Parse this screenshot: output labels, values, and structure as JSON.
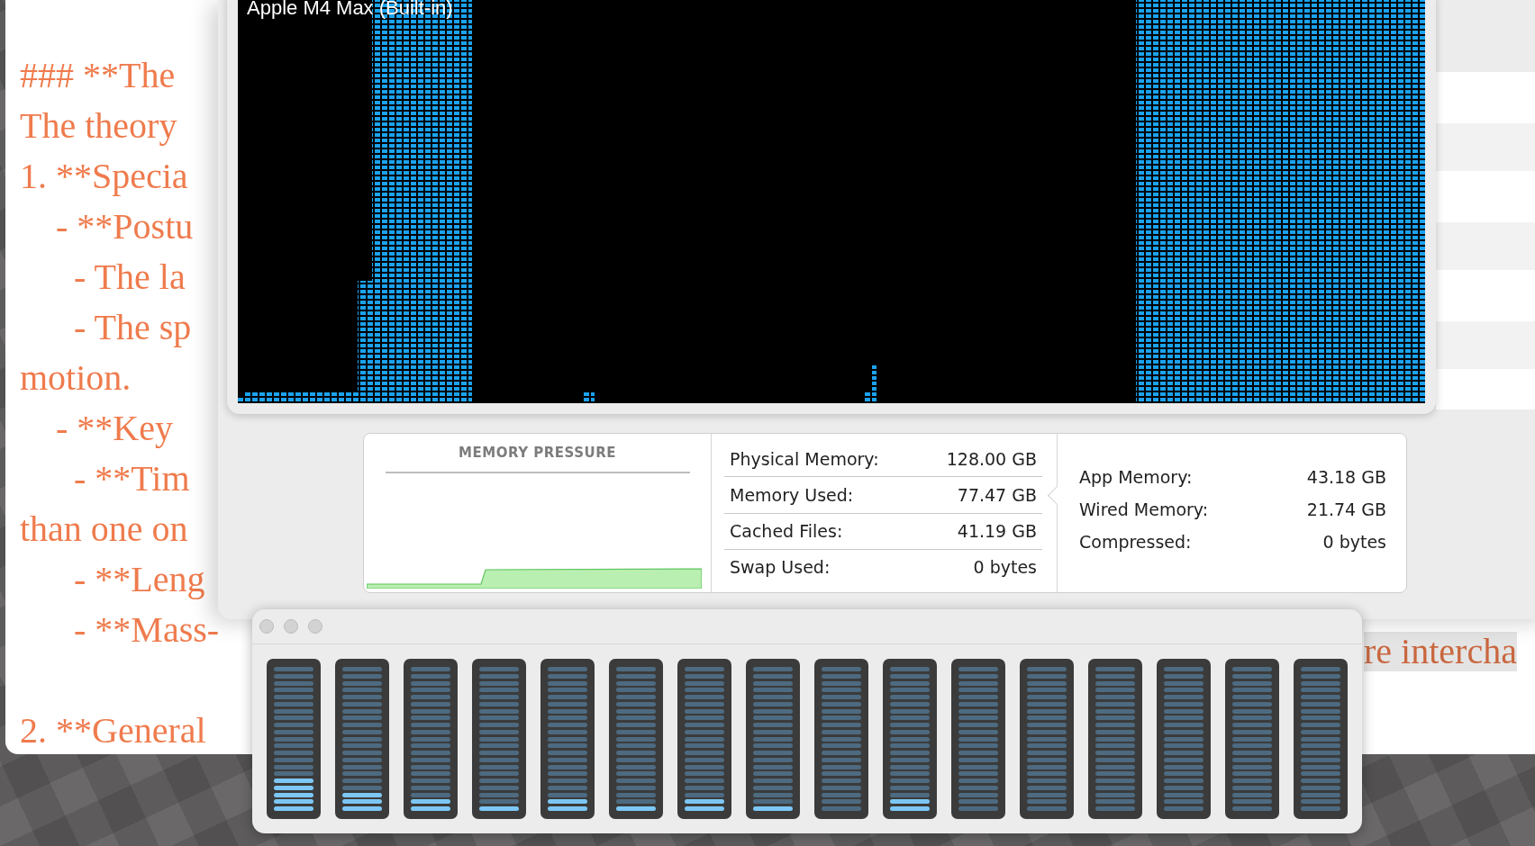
{
  "document_window": {
    "lines": [
      {
        "text": "### **The"
      },
      {
        "text": "The theory"
      },
      {
        "text": "1. **Specia"
      },
      {
        "text": "    - **Postu"
      },
      {
        "text": "      - The la"
      },
      {
        "text": "      - The sp"
      },
      {
        "text": "motion."
      },
      {
        "text": "    - **Key"
      },
      {
        "text": "      - **Tim"
      },
      {
        "text": "than one on"
      },
      {
        "text": "      - **Leng"
      },
      {
        "text": "      - **Mass-",
        "tail": "re intercha"
      },
      {
        "text": "2. **General",
        "gap_before": true
      }
    ]
  },
  "gpu_history_window": {
    "title": "Apple M4 Max (Built-in)"
  },
  "memory": {
    "pressure_title": "MEMORY PRESSURE",
    "stats": [
      {
        "label": "Physical Memory:",
        "value": "128.00 GB"
      },
      {
        "label": "Memory Used:",
        "value": "77.47 GB"
      },
      {
        "label": "Cached Files:",
        "value": "41.19 GB"
      },
      {
        "label": "Swap Used:",
        "value": "0 bytes"
      }
    ],
    "details": [
      {
        "label": "App Memory:",
        "value": "43.18 GB"
      },
      {
        "label": "Wired Memory:",
        "value": "21.74 GB"
      },
      {
        "label": "Compressed:",
        "value": "0 bytes"
      }
    ]
  },
  "cpu_window": {
    "meters": [
      {
        "level": 0.238
      },
      {
        "level": 0.143
      },
      {
        "level": 0.095
      },
      {
        "level": 0.048
      },
      {
        "level": 0.095
      },
      {
        "level": 0.048
      },
      {
        "level": 0.095
      },
      {
        "level": 0.048
      },
      {
        "level": 0
      },
      {
        "level": 0.095
      },
      {
        "level": 0
      },
      {
        "level": 0
      },
      {
        "level": 0
      },
      {
        "level": 0
      },
      {
        "level": 0
      },
      {
        "level": 0
      }
    ]
  }
}
